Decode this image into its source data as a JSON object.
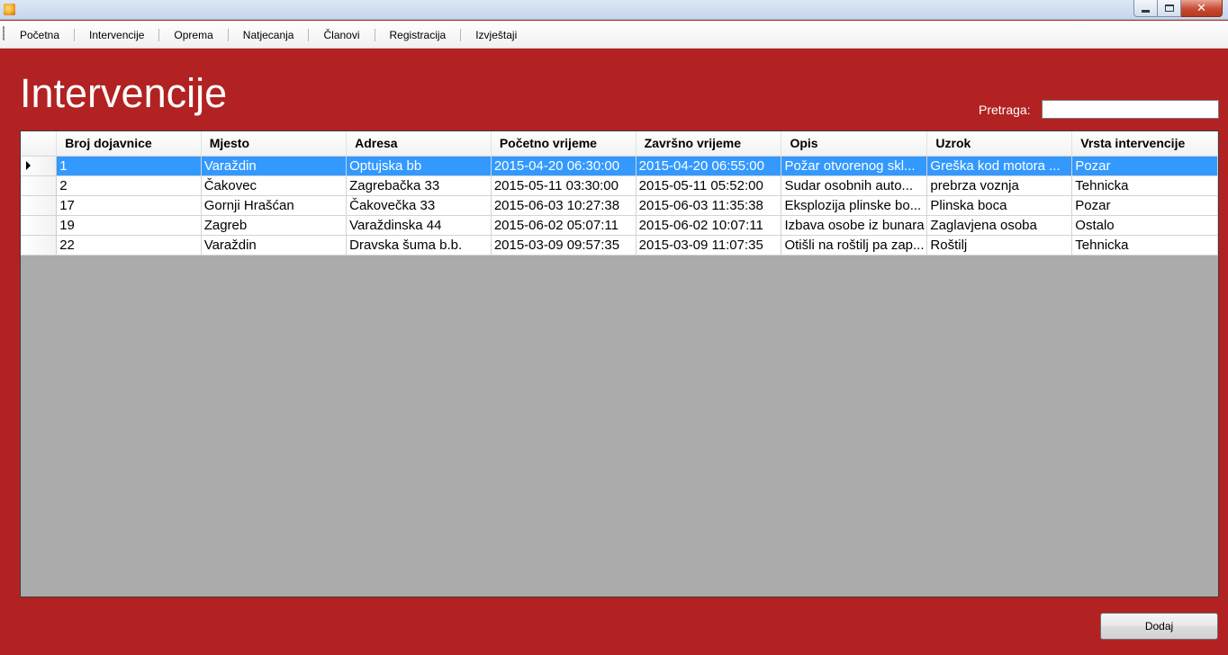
{
  "menu": {
    "items": [
      "Početna",
      "Intervencije",
      "Oprema",
      "Natjecanja",
      "Članovi",
      "Registracija",
      "Izvještaji"
    ]
  },
  "page": {
    "title": "Intervencije"
  },
  "search": {
    "label": "Pretraga:",
    "value": ""
  },
  "grid": {
    "columns": [
      "Broj dojavnice",
      "Mjesto",
      "Adresa",
      "Početno vrijeme",
      "Završno vrijeme",
      "Opis",
      "Uzrok",
      "Vrsta intervencije"
    ],
    "selected_row": 0,
    "rows": [
      [
        "1",
        "Varaždin",
        "Optujska bb",
        "2015-04-20 06:30:00",
        "2015-04-20 06:55:00",
        "Požar otvorenog skl...",
        "Greška kod motora ...",
        "Pozar"
      ],
      [
        "2",
        "Čakovec",
        "Zagrebačka 33",
        "2015-05-11 03:30:00",
        "2015-05-11 05:52:00",
        "Sudar osobnih auto...",
        "prebrza voznja",
        "Tehnicka"
      ],
      [
        "17",
        "Gornji Hrašćan",
        "Čakovečka 33",
        "2015-06-03 10:27:38",
        "2015-06-03 11:35:38",
        "Eksplozija plinske bo...",
        "Plinska boca",
        "Pozar"
      ],
      [
        "19",
        "Zagreb",
        "Varaždinska 44",
        "2015-06-02 05:07:11",
        "2015-06-02 10:07:11",
        "Izbava osobe iz bunara",
        "Zaglavjena osoba",
        "Ostalo"
      ],
      [
        "22",
        "Varaždin",
        "Dravska šuma b.b.",
        "2015-03-09 09:57:35",
        "2015-03-09 11:07:35",
        "Otišli na roštilj pa zap...",
        "Roštilj",
        "Tehnicka"
      ]
    ]
  },
  "actions": {
    "add_label": "Dodaj"
  },
  "colors": {
    "background": "#b22222",
    "selection": "#3399ff",
    "grid_empty": "#ababab"
  }
}
